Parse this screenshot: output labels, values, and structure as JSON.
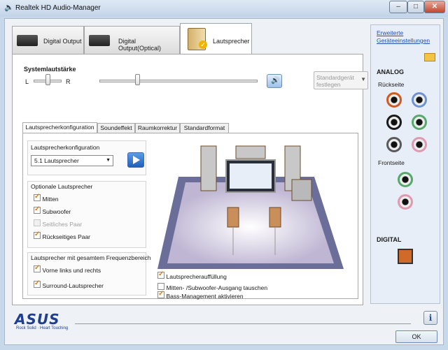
{
  "window": {
    "title": "Realtek HD Audio-Manager"
  },
  "tabs": [
    {
      "label": "Digital Output"
    },
    {
      "label": "Digital Output(Optical)"
    },
    {
      "label": "Lautsprecher"
    }
  ],
  "volume": {
    "label": "Systemlautstärke",
    "left": "L",
    "right": "R",
    "balance": 0.5,
    "level": 0.3
  },
  "default_device": {
    "label": "Standardgerät festlegen"
  },
  "subtabs": [
    "Lautsprecherkonfiguration",
    "Soundeffekt",
    "Raumkorrektur",
    "Standardformat"
  ],
  "speaker_config": {
    "label": "Lautsprecherkonfiguration",
    "selected": "5.1 Lautsprecher"
  },
  "optional_speakers": {
    "title": "Optionale Lautsprecher",
    "items": [
      {
        "label": "Mitten",
        "checked": true,
        "enabled": true
      },
      {
        "label": "Subwoofer",
        "checked": true,
        "enabled": true
      },
      {
        "label": "Seitliches Paar",
        "checked": false,
        "enabled": false
      },
      {
        "label": "Rückseitiges Paar",
        "checked": true,
        "enabled": true
      }
    ]
  },
  "full_range": {
    "title": "Lautsprecher mit gesamtem Frequenzbereich",
    "items": [
      {
        "label": "Vorne links und rechts",
        "checked": true
      },
      {
        "label": "Surround-Lautsprecher",
        "checked": true
      }
    ]
  },
  "bottom_options": [
    {
      "label": "Lautsprecherauffüllung",
      "checked": true
    },
    {
      "label": "Mitten- /Subwoofer-Ausgang tauschen",
      "checked": false
    },
    {
      "label": "Bass-Management aktivieren",
      "checked": true
    }
  ],
  "side": {
    "advanced_link": "Erweiterte Geräteeinstellungen",
    "analog": "ANALOG",
    "rear": "Rückseite",
    "front": "Frontseite",
    "digital": "DIGITAL",
    "jack_colors": [
      "#d25a1e",
      "#6d93d6",
      "#1b1b1b",
      "#56a96b",
      "#5a5a5a",
      "#e09ab0",
      "#56a96b",
      "#e09ab0"
    ]
  },
  "brand": {
    "name": "ASUS",
    "slogan": "Rock Solid · Heart Touching"
  },
  "ok_button": "OK"
}
